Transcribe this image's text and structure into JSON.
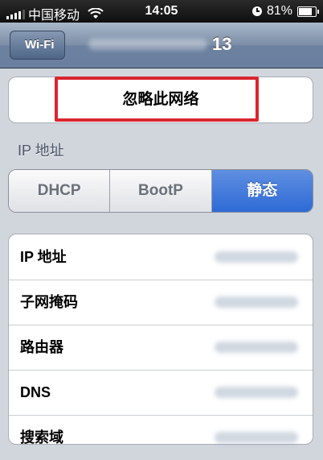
{
  "status_bar": {
    "carrier": "中国移动",
    "time": "14:05",
    "battery": "81%"
  },
  "nav": {
    "back_label": "Wi-Fi",
    "title": "13"
  },
  "forget_network": {
    "label": "忽略此网络"
  },
  "section": {
    "ip_label": "IP 地址"
  },
  "segments": [
    {
      "label": "DHCP",
      "active": false
    },
    {
      "label": "BootP",
      "active": false
    },
    {
      "label": "静态",
      "active": true
    }
  ],
  "fields": [
    {
      "label": "IP 地址"
    },
    {
      "label": "子网掩码"
    },
    {
      "label": "路由器"
    },
    {
      "label": "DNS"
    },
    {
      "label": "搜索域"
    }
  ],
  "colors": {
    "highlight": "#d9262f",
    "segment_active": "#2e6ad6"
  }
}
